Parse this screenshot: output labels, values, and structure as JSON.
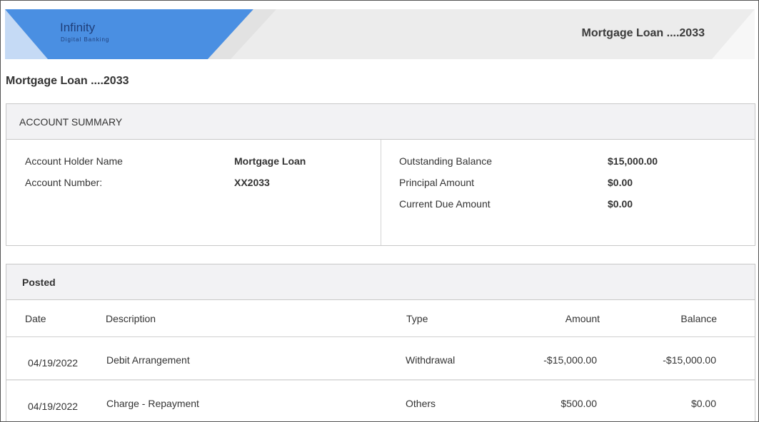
{
  "brand": {
    "name": "Infinity",
    "tagline": "Digital Banking",
    "color_primary": "#4a8fe2",
    "color_light": "#c5daf5"
  },
  "banner": {
    "account_title": "Mortgage Loan ....2033"
  },
  "page": {
    "title": "Mortgage Loan ....2033"
  },
  "summary": {
    "heading": "ACCOUNT SUMMARY",
    "left": [
      {
        "label": "Account Holder Name",
        "value": "Mortgage Loan"
      },
      {
        "label": "Account Number:",
        "value": "XX2033"
      }
    ],
    "right": [
      {
        "label": "Outstanding Balance",
        "value": "$15,000.00"
      },
      {
        "label": "Principal Amount",
        "value": "$0.00"
      },
      {
        "label": "Current Due Amount",
        "value": "$0.00"
      }
    ]
  },
  "posted": {
    "heading": "Posted",
    "columns": {
      "date": "Date",
      "description": "Description",
      "type": "Type",
      "amount": "Amount",
      "balance": "Balance"
    },
    "rows": [
      {
        "date": "04/19/2022",
        "description": "Debit Arrangement",
        "type": "Withdrawal",
        "amount": "-$15,000.00",
        "balance": "-$15,000.00"
      },
      {
        "date": "04/19/2022",
        "description": "Charge - Repayment",
        "type": "Others",
        "amount": "$500.00",
        "balance": "$0.00"
      }
    ]
  }
}
